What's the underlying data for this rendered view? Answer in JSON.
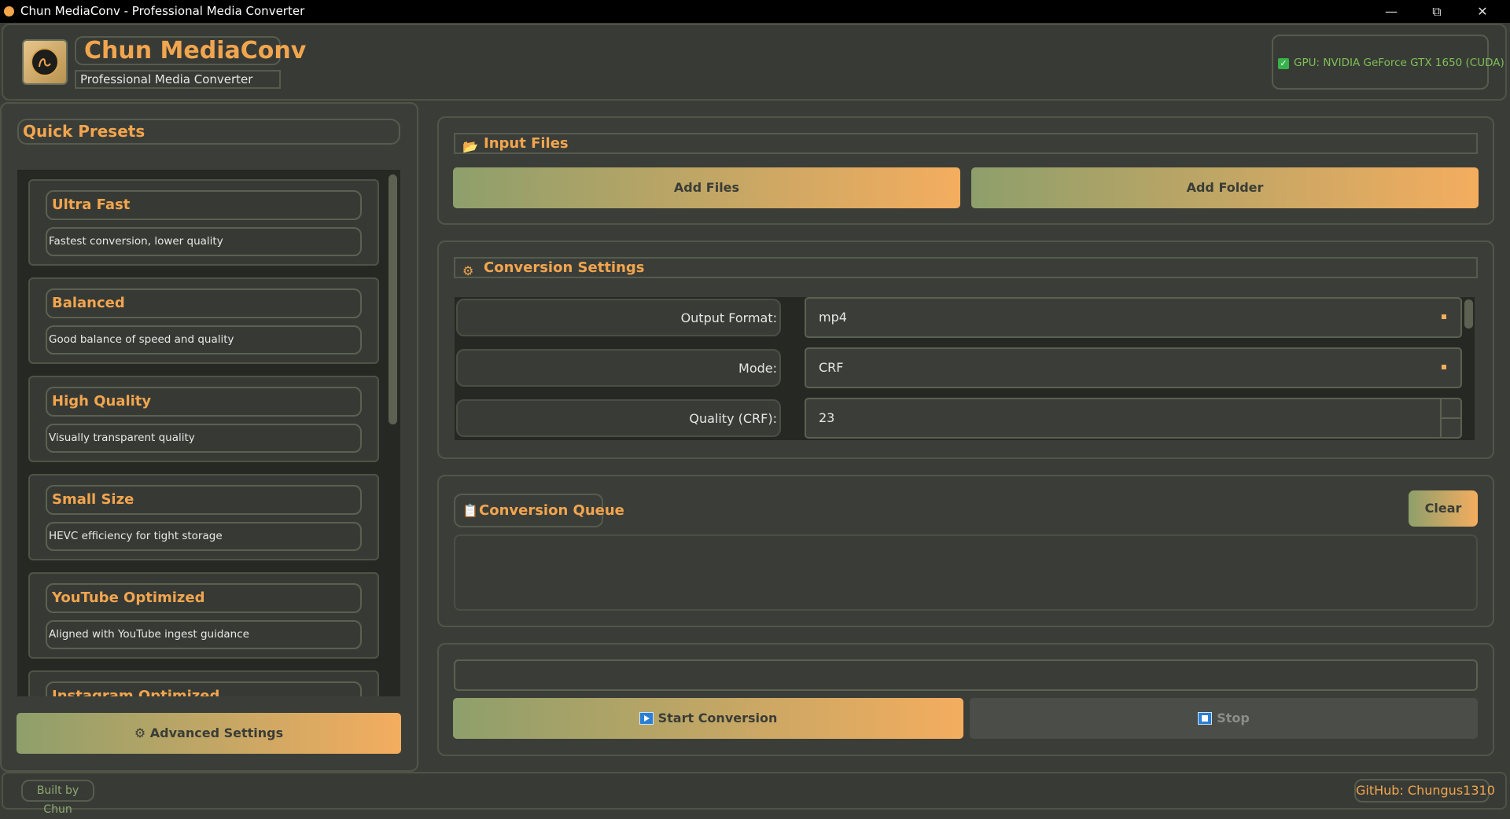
{
  "window": {
    "title": "Chun MediaConv - Professional Media Converter"
  },
  "header": {
    "app_name": "Chun MediaConv",
    "subtitle": "Professional Media Converter",
    "gpu_status": "GPU: NVIDIA GeForce GTX 1650 (CUDA)"
  },
  "presets": {
    "title": "Quick Presets",
    "items": [
      {
        "name": "Ultra Fast",
        "description": "Fastest conversion, lower quality"
      },
      {
        "name": "Balanced",
        "description": "Good balance of speed and quality"
      },
      {
        "name": "High Quality",
        "description": "Visually transparent quality"
      },
      {
        "name": "Small Size",
        "description": "HEVC efficiency for tight storage"
      },
      {
        "name": "YouTube Optimized",
        "description": "Aligned with YouTube ingest guidance"
      },
      {
        "name": "Instagram Optimized",
        "description": ""
      }
    ],
    "advanced_button": "Advanced Settings"
  },
  "input": {
    "title": "Input Files",
    "add_files": "Add Files",
    "add_folder": "Add Folder"
  },
  "settings": {
    "title": "Conversion Settings",
    "output_format_label": "Output Format:",
    "output_format_value": "mp4",
    "mode_label": "Mode:",
    "mode_value": "CRF",
    "quality_label": "Quality (CRF):",
    "quality_value": "23"
  },
  "queue": {
    "title": "Conversion Queue",
    "clear": "Clear"
  },
  "actions": {
    "start": "Start Conversion",
    "stop": "Stop"
  },
  "footer": {
    "built_by": "Built by Chun",
    "github": "GitHub: Chungus1310"
  },
  "colors": {
    "accent": "#f2a54f",
    "gradient_start": "#8e9f6b",
    "gradient_end": "#f4ad5f",
    "background": "#3a3d37"
  }
}
